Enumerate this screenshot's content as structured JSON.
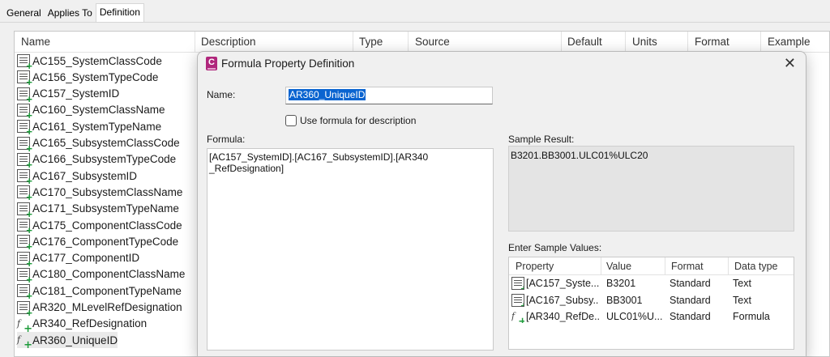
{
  "tabs": [
    "General",
    "Applies To",
    "Definition"
  ],
  "active_tab": "Definition",
  "list": {
    "columns": [
      "Name",
      "Description",
      "Type",
      "Source",
      "Default",
      "Units",
      "Format",
      "Example"
    ],
    "rows": [
      {
        "name": "AC155_SystemClassCode",
        "icon": "property-icon"
      },
      {
        "name": "AC156_SystemTypeCode",
        "icon": "property-icon"
      },
      {
        "name": "AC157_SystemID",
        "icon": "property-icon"
      },
      {
        "name": "AC160_SystemClassName",
        "icon": "property-icon"
      },
      {
        "name": "AC161_SystemTypeName",
        "icon": "property-icon"
      },
      {
        "name": "AC165_SubsystemClassCode",
        "icon": "property-icon"
      },
      {
        "name": "AC166_SubsystemTypeCode",
        "icon": "property-icon"
      },
      {
        "name": "AC167_SubsystemID",
        "icon": "property-icon"
      },
      {
        "name": "AC170_SubsystemClassName",
        "icon": "property-icon"
      },
      {
        "name": "AC171_SubsystemTypeName",
        "icon": "property-icon"
      },
      {
        "name": "AC175_ComponentClassCode",
        "icon": "property-icon"
      },
      {
        "name": "AC176_ComponentTypeCode",
        "icon": "property-icon"
      },
      {
        "name": "AC177_ComponentID",
        "icon": "property-icon"
      },
      {
        "name": "AC180_ComponentClassName",
        "icon": "property-icon"
      },
      {
        "name": "AC181_ComponentTypeName",
        "icon": "property-icon"
      },
      {
        "name": "AR320_MLevelRefDesignation",
        "icon": "property-icon"
      },
      {
        "name": "AR340_RefDesignation",
        "icon": "formula-icon"
      },
      {
        "name": "AR360_UniqueID",
        "icon": "formula-icon"
      }
    ]
  },
  "dialog": {
    "title": "Formula Property Definition",
    "close_glyph": "✕",
    "app_icon_letter": "C",
    "name_label": "Name:",
    "name_value": "AR360_UniqueID",
    "checkbox_label": "Use formula for description",
    "formula_label": "Formula:",
    "formula_value": "[AC157_SystemID].[AC167_SubsystemID].[AR340\n_RefDesignation]",
    "sample_result_label": "Sample Result:",
    "sample_result_value": "B3201.BB3001.ULC01%ULC20",
    "sample_values_label": "Enter Sample Values:",
    "sample_grid": {
      "columns": [
        "Property",
        "Value",
        "Format",
        "Data type"
      ],
      "rows": [
        {
          "property": "[AC157_Syste...",
          "value": "B3201",
          "format": "Standard",
          "data_type": "Text",
          "icon": "property-icon"
        },
        {
          "property": "[AC167_Subsy...",
          "value": "BB3001",
          "format": "Standard",
          "data_type": "Text",
          "icon": "property-icon"
        },
        {
          "property": "[AR340_RefDe...",
          "value": "ULC01%U...",
          "format": "Standard",
          "data_type": "Formula",
          "icon": "formula-icon"
        }
      ]
    }
  },
  "colors": {
    "selection": "#0a64d0",
    "app_icon": "#b0267c",
    "add_badge": "#1c9b3a"
  }
}
